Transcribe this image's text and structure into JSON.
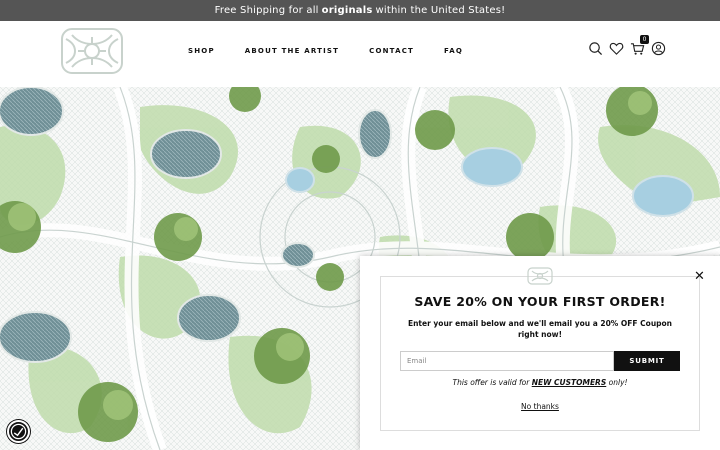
{
  "announcement": {
    "before": "Free Shipping for all",
    "bold": "originals",
    "after": "within the United States!"
  },
  "header": {
    "logo_icon": "ornamental-logo",
    "nav": [
      {
        "label": "SHOP"
      },
      {
        "label": "ABOUT THE ARTIST"
      },
      {
        "label": "CONTACT"
      },
      {
        "label": "FAQ"
      }
    ],
    "cart_count": "0",
    "icons": [
      "search-icon",
      "heart-icon",
      "cart-icon",
      "account-icon"
    ]
  },
  "popup": {
    "title": "SAVE 20% ON YOUR FIRST ORDER!",
    "subtitle": "Enter your email below and we'll email you a 20% OFF Coupon right now!",
    "email_placeholder": "Email",
    "email_value": "",
    "submit_label": "SUBMIT",
    "offer_before": "This offer is valid for",
    "offer_bold": "NEW CUSTOMERS",
    "offer_after": "only!",
    "no_thanks": "No thanks",
    "close_symbol": "✕"
  },
  "colors": {
    "announcement_bg": "#555555",
    "button_bg": "#111111",
    "hero_green": "#b9d8a8",
    "hero_pool": "#a7cfe1"
  }
}
